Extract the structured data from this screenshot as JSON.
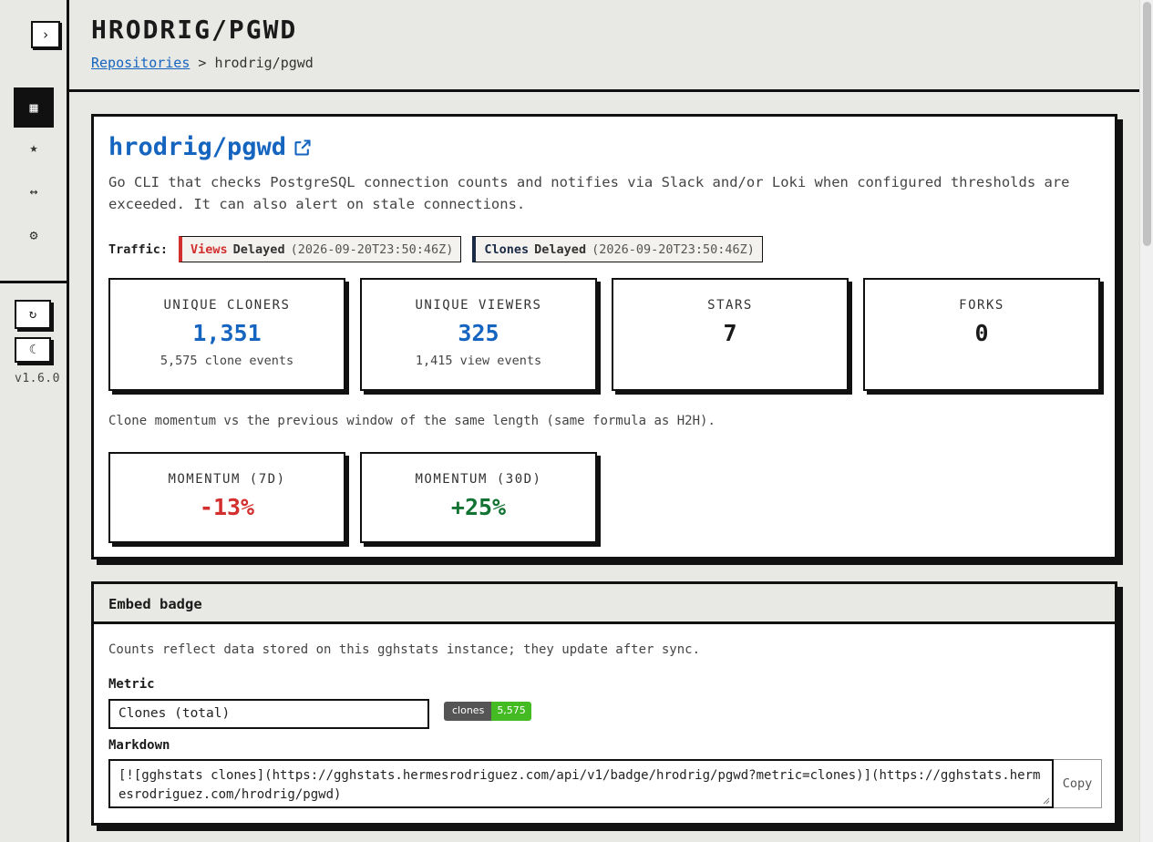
{
  "app": {
    "version": "v1.6.0"
  },
  "sidebar": {
    "toggle_glyph": "›",
    "items": [
      {
        "name": "dashboard",
        "glyph": "▦"
      },
      {
        "name": "stars",
        "glyph": "★"
      },
      {
        "name": "compare",
        "glyph": "↔"
      },
      {
        "name": "settings",
        "glyph": "⚙"
      }
    ],
    "refresh_glyph": "↻",
    "theme_glyph": "☾"
  },
  "header": {
    "title": "HRODRIG/PGWD",
    "breadcrumb": {
      "link": "Repositories",
      "separator": ">",
      "current": "hrodrig/pgwd"
    }
  },
  "repo": {
    "name": "hrodrig/pgwd",
    "description": "Go CLI that checks PostgreSQL connection counts and notifies via Slack and/or Loki when configured thresholds are exceeded. It can also alert on stale connections.",
    "traffic": {
      "label": "Traffic:",
      "views": {
        "kind": "Views",
        "state": "Delayed",
        "time": "(2026-09-20T23:50:46Z)"
      },
      "clones": {
        "kind": "Clones",
        "state": "Delayed",
        "time": "(2026-09-20T23:50:46Z)"
      }
    },
    "stats": [
      {
        "label": "UNIQUE CLONERS",
        "value": "1,351",
        "sub": "5,575 clone events"
      },
      {
        "label": "UNIQUE VIEWERS",
        "value": "325",
        "sub": "1,415 view events"
      },
      {
        "label": "STARS",
        "value": "7"
      },
      {
        "label": "FORKS",
        "value": "0"
      }
    ],
    "momentum_note": "Clone momentum vs the previous window of the same length (same formula as H2H).",
    "momentum": [
      {
        "label": "MOMENTUM (7D)",
        "value": "-13%"
      },
      {
        "label": "MOMENTUM (30D)",
        "value": "+25%"
      }
    ]
  },
  "embed": {
    "title": "Embed badge",
    "note": "Counts reflect data stored on this gghstats instance; they update after sync.",
    "metric_label": "Metric",
    "metric_value": "Clones (total)",
    "badge": {
      "left": "clones",
      "right": "5,575"
    },
    "markdown_label": "Markdown",
    "markdown_value": "[![gghstats clones](https://gghstats.hermesrodriguez.com/api/v1/badge/hrodrig/pgwd?metric=clones)](https://gghstats.hermesrodriguez.com/hrodrig/pgwd)",
    "copy_label": "Copy"
  },
  "colors": {
    "link": "#1565c0",
    "negative": "#d32f2f",
    "positive": "#137333",
    "badge_green": "#44bb22"
  }
}
